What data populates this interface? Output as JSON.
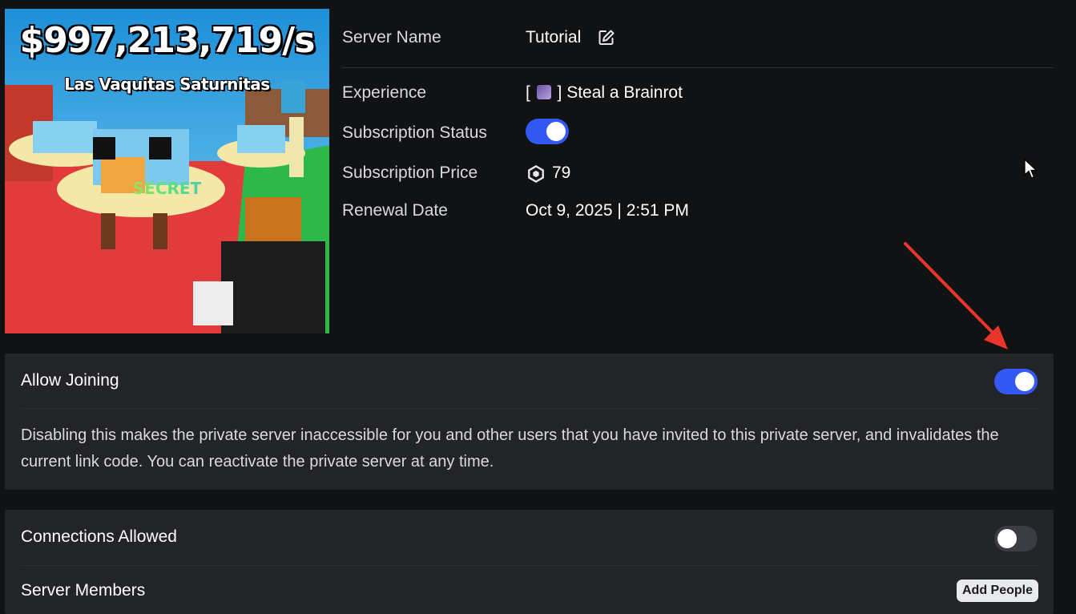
{
  "thumbnail": {
    "title": "$997,213,719/s",
    "subtitle": "Las Vaquitas Saturnitas",
    "tag": "SECRET"
  },
  "server_info": {
    "server_name_label": "Server Name",
    "server_name_value": "Tutorial",
    "experience_label": "Experience",
    "experience_value": "] Steal a Brainrot",
    "experience_prefix": "[",
    "subscription_status_label": "Subscription Status",
    "subscription_status_on": true,
    "subscription_price_label": "Subscription Price",
    "subscription_price_value": "79",
    "renewal_date_label": "Renewal Date",
    "renewal_date_value": "Oct 9, 2025 | 2:51 PM"
  },
  "allow_joining": {
    "title": "Allow Joining",
    "enabled": true,
    "description": "Disabling this makes the private server inaccessible for you and other users that you have invited to this private server, and invalidates the current link code. You can reactivate the private server at any time."
  },
  "connections": {
    "title": "Connections Allowed",
    "enabled": false,
    "members_label": "Server Members",
    "add_people_label": "Add People"
  },
  "colors": {
    "background": "#111214",
    "panel": "#232428",
    "toggle_on": "#3358f4",
    "toggle_off": "#3b3d42",
    "annotation_arrow": "#e8362a"
  },
  "icons": [
    "edit-icon",
    "robux-icon",
    "mouse-cursor-icon",
    "annotation-arrow"
  ]
}
